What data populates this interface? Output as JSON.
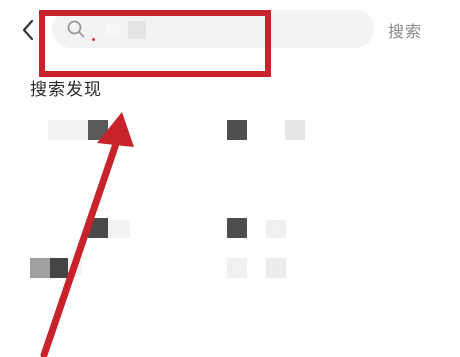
{
  "header": {
    "back_icon": "chevron-left-icon",
    "search_icon": "search-icon",
    "search_button": "搜索"
  },
  "discover": {
    "title": "搜索发现"
  },
  "annotation": {
    "highlight_color": "#c8232a",
    "arrow_color": "#c8232a"
  }
}
